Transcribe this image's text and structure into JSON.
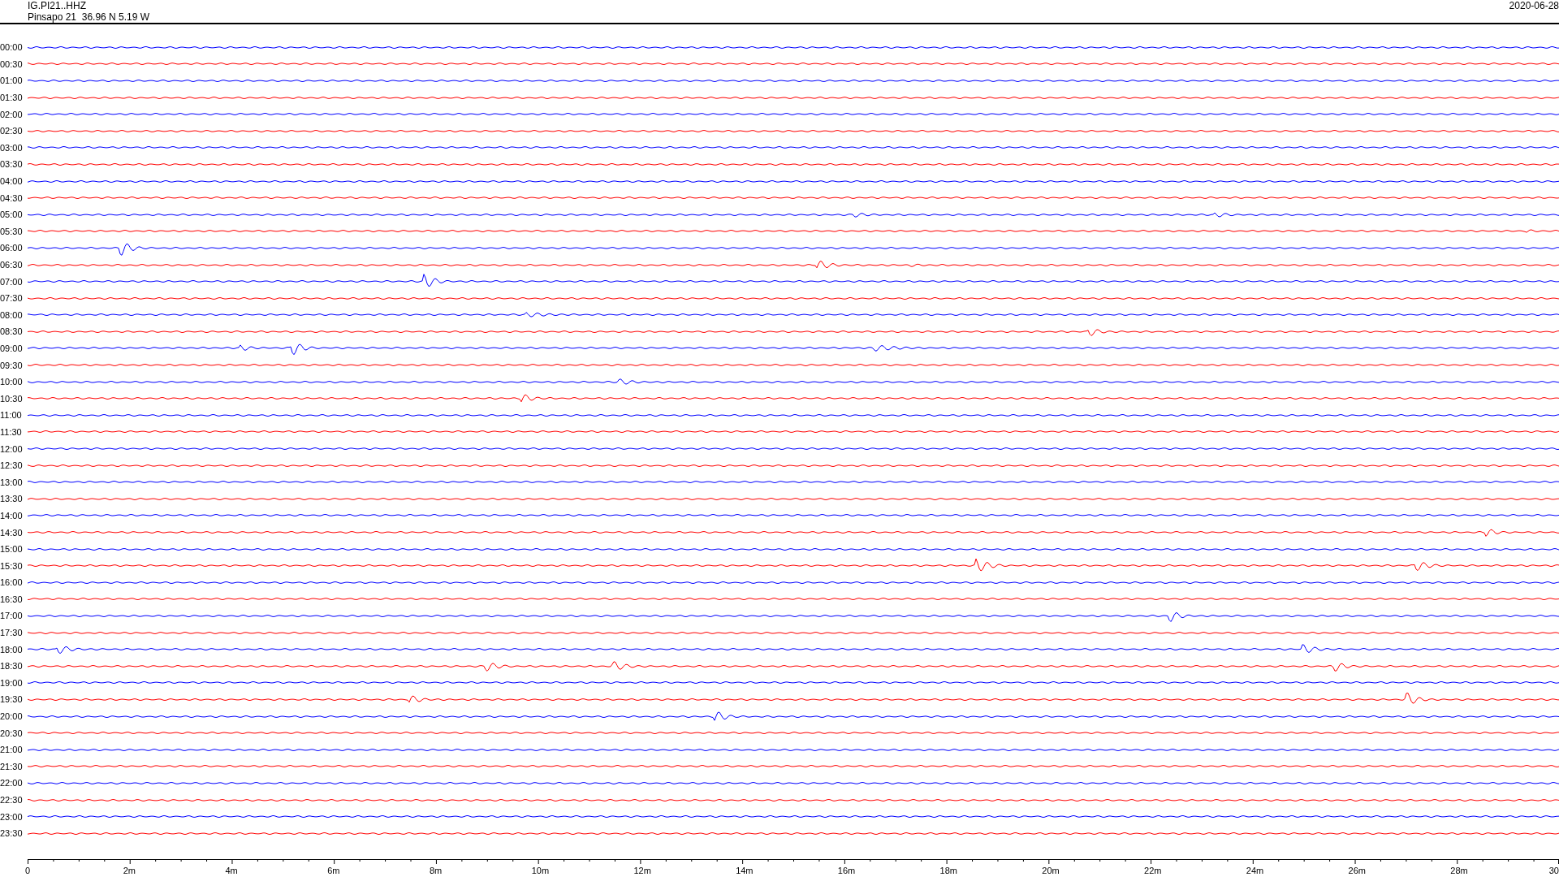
{
  "header": {
    "station": "IG.PI21..HHZ",
    "location": "Pinsapo 21  36.96 N 5.19 W",
    "date": "2020-06-28"
  },
  "rows": [
    {
      "time": "00:00",
      "color": "#0000ff"
    },
    {
      "time": "00:30",
      "color": "#ff0000"
    },
    {
      "time": "01:00",
      "color": "#0000ff"
    },
    {
      "time": "01:30",
      "color": "#ff0000"
    },
    {
      "time": "02:00",
      "color": "#0000ff"
    },
    {
      "time": "02:30",
      "color": "#ff0000"
    },
    {
      "time": "03:00",
      "color": "#0000ff"
    },
    {
      "time": "03:30",
      "color": "#ff0000"
    },
    {
      "time": "04:00",
      "color": "#0000ff"
    },
    {
      "time": "04:30",
      "color": "#ff0000"
    },
    {
      "time": "05:00",
      "color": "#0000ff"
    },
    {
      "time": "05:30",
      "color": "#ff0000"
    },
    {
      "time": "06:00",
      "color": "#0000ff"
    },
    {
      "time": "06:30",
      "color": "#ff0000"
    },
    {
      "time": "07:00",
      "color": "#0000ff"
    },
    {
      "time": "07:30",
      "color": "#ff0000"
    },
    {
      "time": "08:00",
      "color": "#0000ff"
    },
    {
      "time": "08:30",
      "color": "#ff0000"
    },
    {
      "time": "09:00",
      "color": "#0000ff"
    },
    {
      "time": "09:30",
      "color": "#ff0000"
    },
    {
      "time": "10:00",
      "color": "#0000ff"
    },
    {
      "time": "10:30",
      "color": "#ff0000"
    },
    {
      "time": "11:00",
      "color": "#0000ff"
    },
    {
      "time": "11:30",
      "color": "#ff0000"
    },
    {
      "time": "12:00",
      "color": "#0000ff"
    },
    {
      "time": "12:30",
      "color": "#ff0000"
    },
    {
      "time": "13:00",
      "color": "#0000ff"
    },
    {
      "time": "13:30",
      "color": "#ff0000"
    },
    {
      "time": "14:00",
      "color": "#0000ff"
    },
    {
      "time": "14:30",
      "color": "#ff0000"
    },
    {
      "time": "15:00",
      "color": "#0000ff"
    },
    {
      "time": "15:30",
      "color": "#ff0000"
    },
    {
      "time": "16:00",
      "color": "#0000ff"
    },
    {
      "time": "16:30",
      "color": "#ff0000"
    },
    {
      "time": "17:00",
      "color": "#0000ff"
    },
    {
      "time": "17:30",
      "color": "#ff0000"
    },
    {
      "time": "18:00",
      "color": "#0000ff"
    },
    {
      "time": "18:30",
      "color": "#ff0000"
    },
    {
      "time": "19:00",
      "color": "#0000ff"
    },
    {
      "time": "19:30",
      "color": "#ff0000"
    },
    {
      "time": "20:00",
      "color": "#0000ff"
    },
    {
      "time": "20:30",
      "color": "#ff0000"
    },
    {
      "time": "21:00",
      "color": "#0000ff"
    },
    {
      "time": "21:30",
      "color": "#ff0000"
    },
    {
      "time": "22:00",
      "color": "#0000ff"
    },
    {
      "time": "22:30",
      "color": "#ff0000"
    },
    {
      "time": "23:00",
      "color": "#0000ff"
    },
    {
      "time": "23:30",
      "color": "#ff0000"
    }
  ],
  "axis": {
    "labels": [
      "0",
      "2m",
      "4m",
      "6m",
      "8m",
      "10m",
      "12m",
      "14m",
      "16m",
      "18m",
      "20m",
      "22m",
      "24m",
      "26m",
      "28m",
      "30"
    ]
  }
}
